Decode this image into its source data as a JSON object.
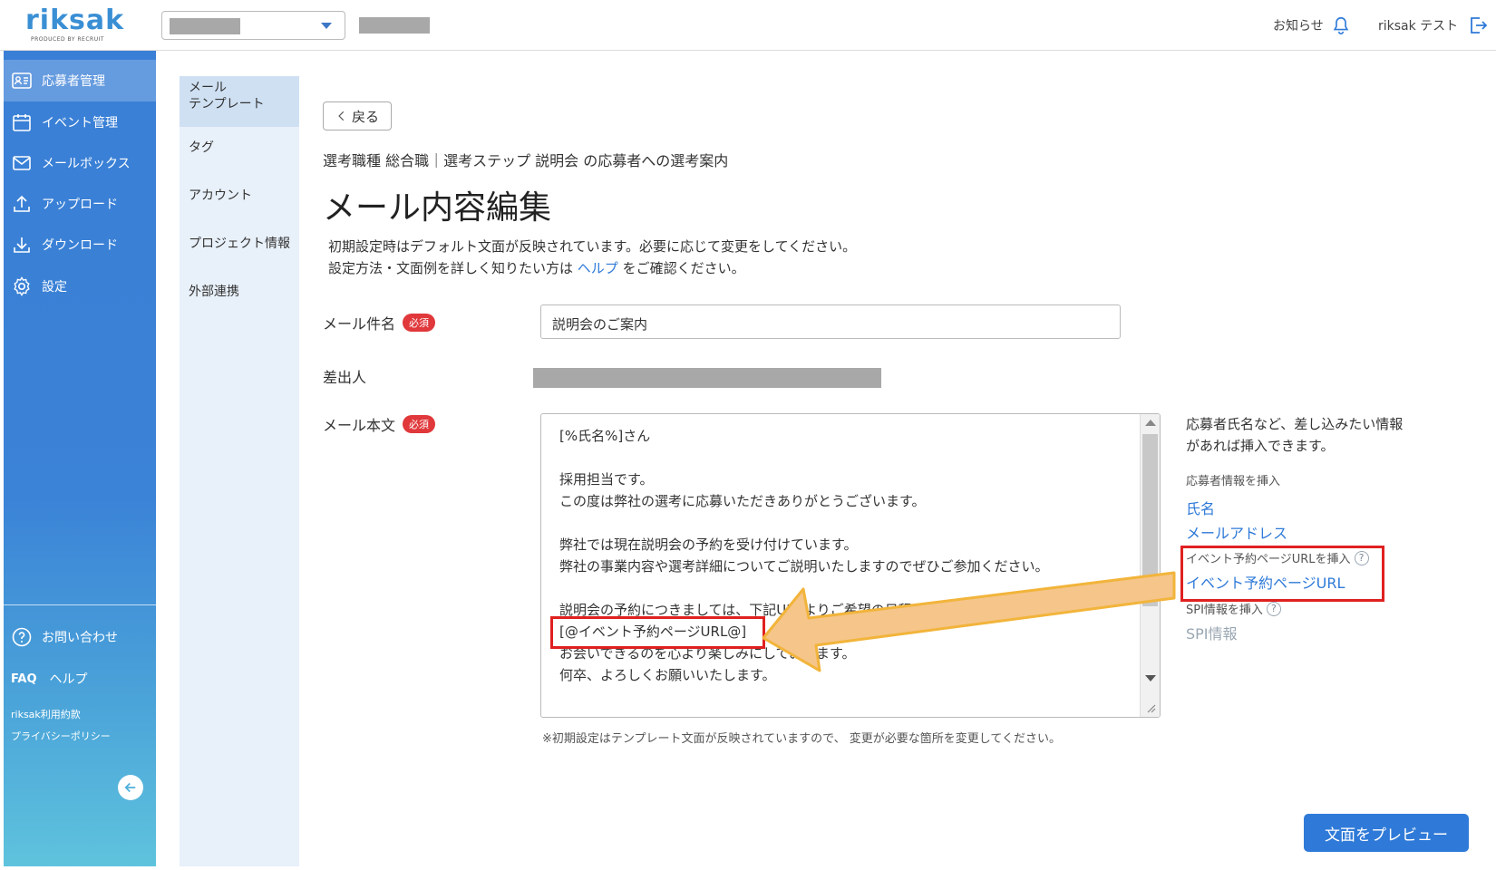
{
  "header": {
    "logo_text": "riksak",
    "logo_sub": "PRODUCED BY RECRUIT",
    "notice_label": "お知らせ",
    "user_name": "riksak テスト"
  },
  "sidebar": {
    "items": [
      {
        "label": "応募者管理",
        "icon": "applicant-card-icon"
      },
      {
        "label": "イベント管理",
        "icon": "calendar-icon"
      },
      {
        "label": "メールボックス",
        "icon": "mail-icon"
      },
      {
        "label": "アップロード",
        "icon": "upload-icon"
      },
      {
        "label": "ダウンロード",
        "icon": "download-icon"
      },
      {
        "label": "設定",
        "icon": "gear-icon"
      }
    ],
    "contact_label": "お問い合わせ",
    "faq_prefix": "FAQ",
    "help_label": "ヘルプ",
    "terms_label": "riksak利用約款",
    "privacy_label": "プライバシーポリシー"
  },
  "subnav": {
    "items": [
      "メール\nテンプレート",
      "タグ",
      "アカウント",
      "プロジェクト情報",
      "外部連携"
    ]
  },
  "main": {
    "back_label": "戻る",
    "breadcrumb": "選考職種 総合職｜選考ステップ 説明会 の応募者への選考案内",
    "title": "メール内容編集",
    "intro_line1": "初期設定時はデフォルト文面が反映されています。必要に応じて変更をしてください。",
    "intro_line2_pre": "設定方法・文面例を詳しく知りたい方は ",
    "intro_help_link": "ヘルプ",
    "intro_line2_post": " をご確認ください。",
    "subject_label": "メール件名",
    "required_badge": "必須",
    "subject_value": "説明会のご案内",
    "sender_label": "差出人",
    "body_label": "メール本文",
    "body_text": "[%氏名%]さん\n\n採用担当です。\nこの度は弊社の選考に応募いただきありがとうございます。\n\n弊社では現在説明会の予約を受け付けています。\n弊社の事業内容や選考詳細についてご説明いたしますのでぜひご参加ください。\n\n説明会の予約につきましては、下記URLよりご希望の日程をお選びください。\n[@イベント予約ページURL@]\nお会いできるのを心より楽しみにしております。\n何卒、よろしくお願いいたします。",
    "note": "※初期設定はテンプレート文面が反映されていますので、 変更が必要な箇所を変更してください。",
    "preview_button": "文面をプレビュー"
  },
  "insert_panel": {
    "description": "応募者氏名など、差し込みたい情報\nがあれば挿入できます。",
    "applicant_heading": "応募者情報を挿入",
    "name_link": "氏名",
    "email_link": "メールアドレス",
    "event_heading": "イベント予約ページURLを挿入",
    "event_link": "イベント予約ページURL",
    "spi_heading": "SPI情報を挿入",
    "spi_link": "SPI情報"
  },
  "colors": {
    "accent": "#2f7ad8",
    "required": "#e0383b",
    "highlight": "#e02020",
    "arrow_fill": "#f5c58a",
    "arrow_stroke": "#f2b43a"
  }
}
